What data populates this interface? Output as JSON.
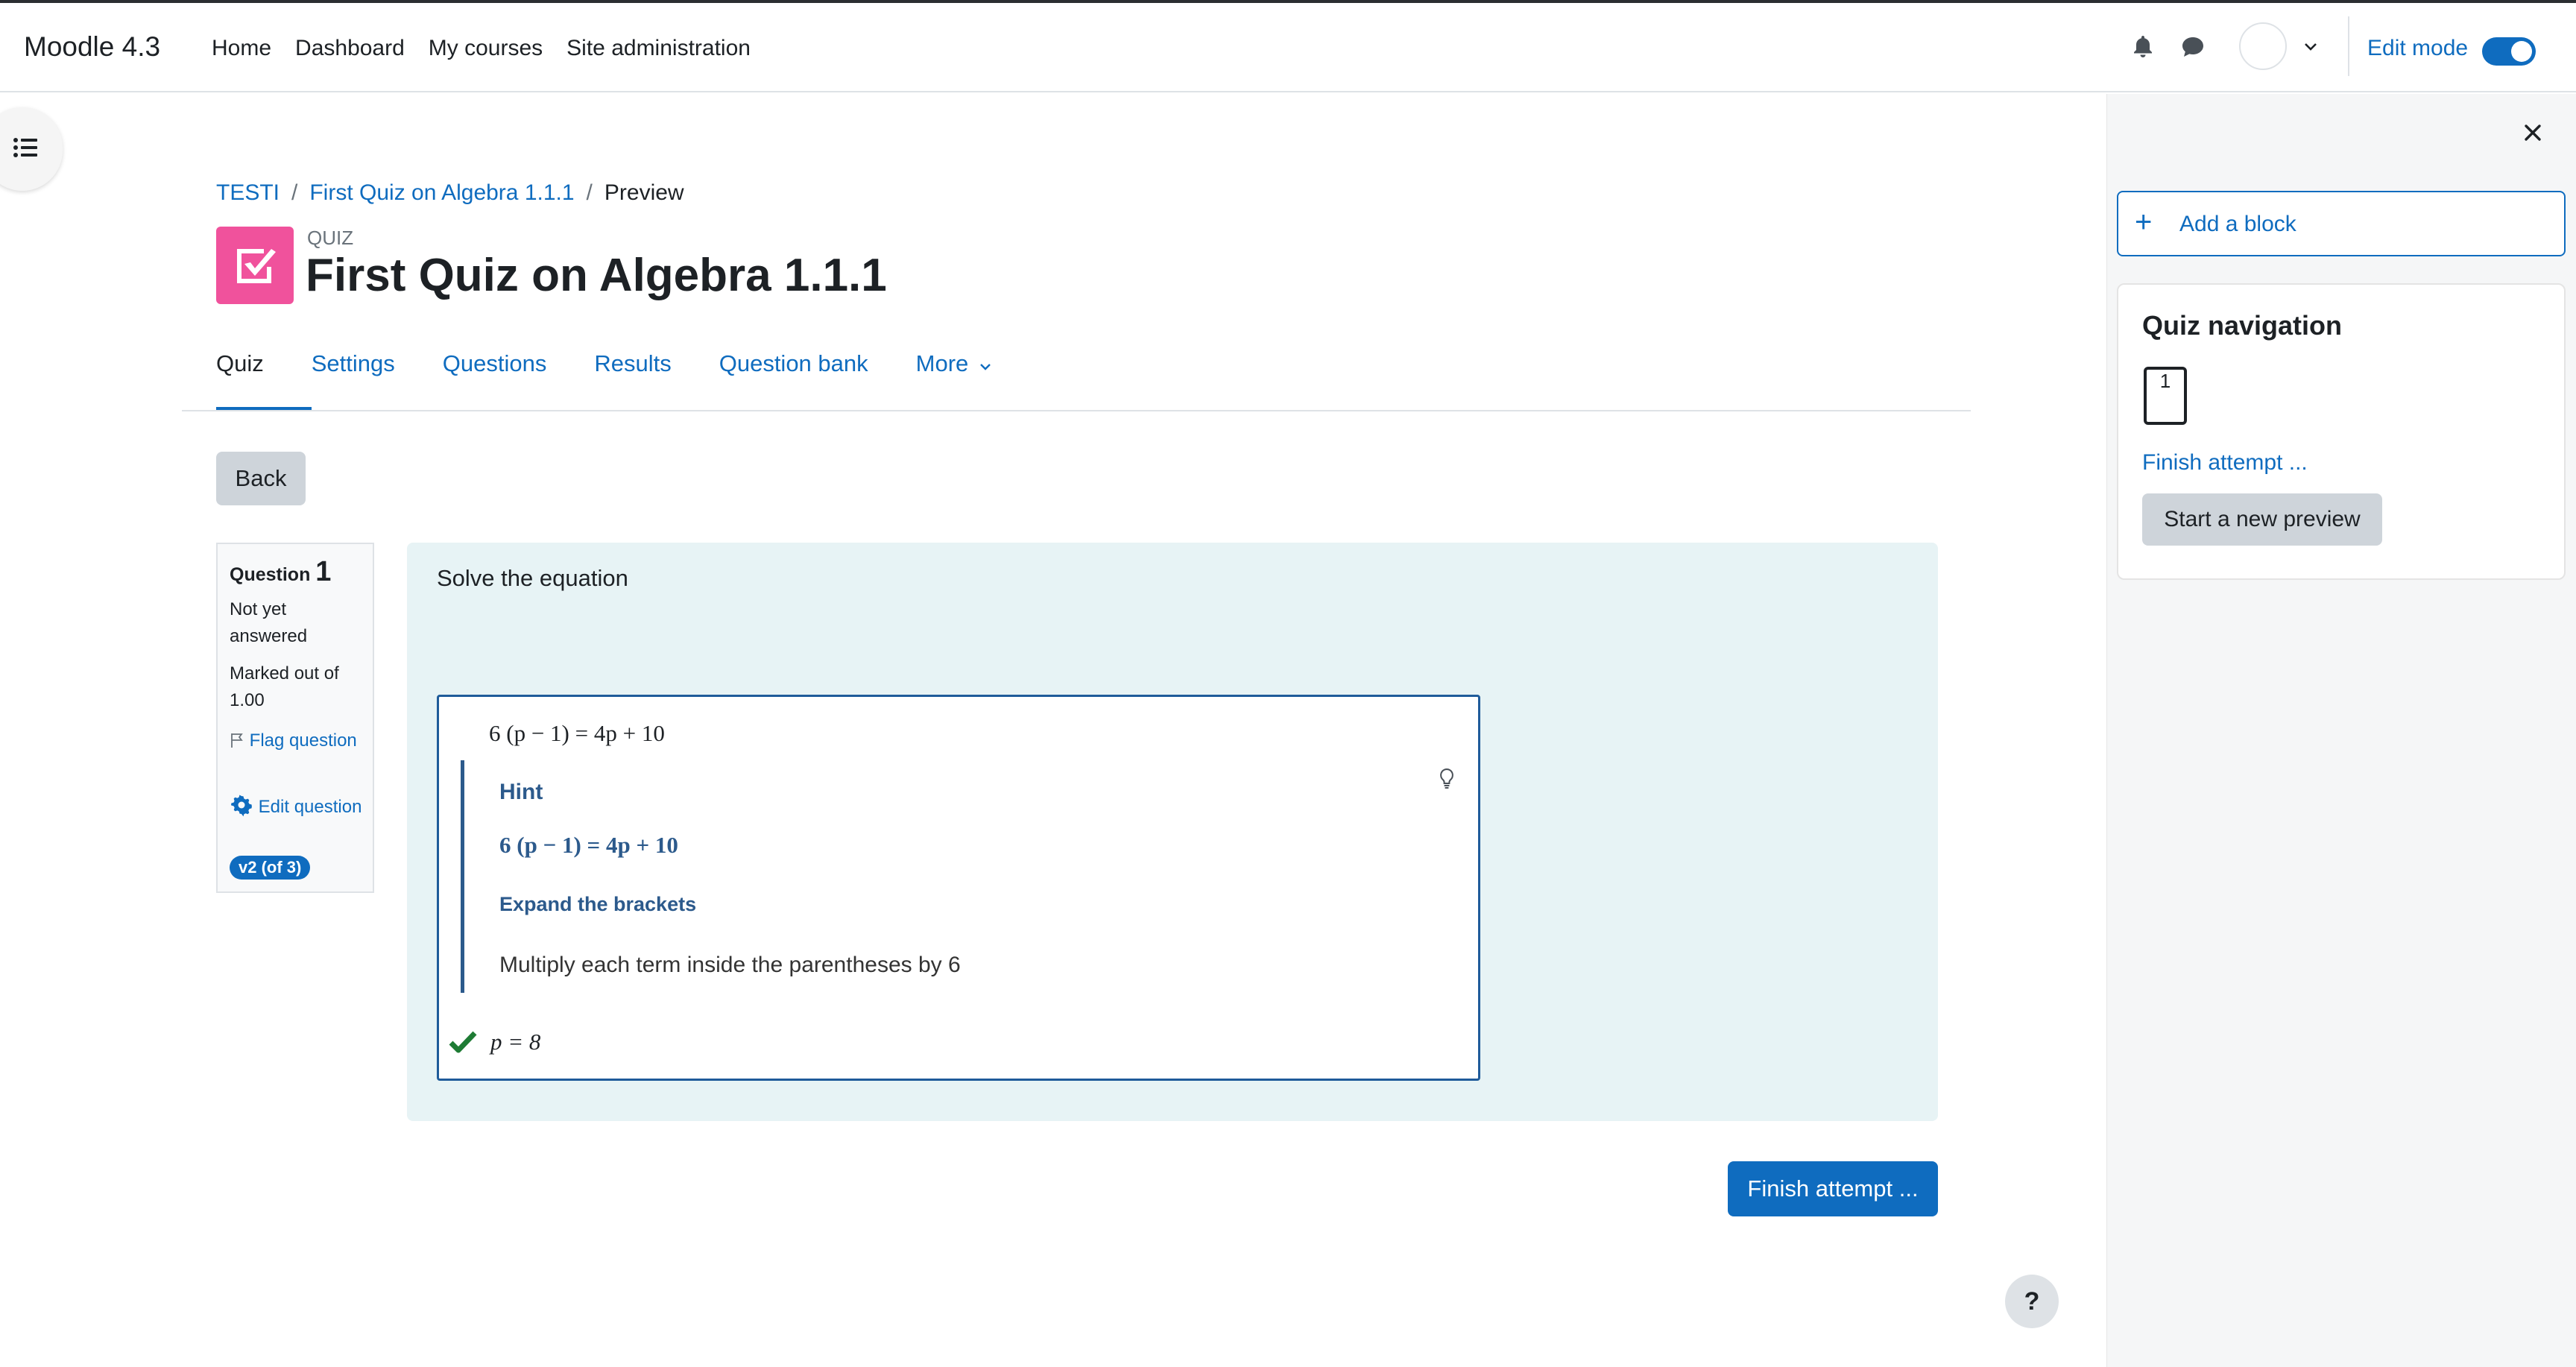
{
  "brand": "Moodle 4.3",
  "primary_nav": {
    "home": "Home",
    "dashboard": "Dashboard",
    "my_courses": "My courses",
    "site_admin": "Site administration"
  },
  "edit_mode": {
    "label": "Edit mode",
    "enabled": true
  },
  "breadcrumb": {
    "course": "TESTI",
    "quiz": "First Quiz on Algebra 1.1.1",
    "current": "Preview",
    "separator": "/"
  },
  "header": {
    "module_type": "QUIZ",
    "title": "First Quiz on Algebra 1.1.1"
  },
  "secondary_nav": {
    "quiz": "Quiz",
    "settings": "Settings",
    "questions": "Questions",
    "results": "Results",
    "question_bank": "Question bank",
    "more": "More"
  },
  "back_label": "Back",
  "question": {
    "label": "Question",
    "number": "1",
    "state": "Not yet answered",
    "grade": "Marked out of 1.00",
    "flag_label": "Flag question",
    "edit_label": "Edit question",
    "version": "v2 (of 3)",
    "text": "Solve the equation",
    "equation": "6 (p − 1) = 4p + 10",
    "hint_title": "Hint",
    "hint_equation": "6 (p − 1) = 4p + 10",
    "hint_subtitle": "Expand the brackets",
    "hint_text": "Multiply each term inside the parentheses by 6",
    "answer": "p = 8"
  },
  "finish_button": "Finish attempt ...",
  "help_label": "?",
  "drawer": {
    "add_block": "Add a block",
    "add_block_icon": "+",
    "quiz_nav_title": "Quiz navigation",
    "question_buttons": [
      "1"
    ],
    "finish_link": "Finish attempt ...",
    "new_preview": "Start a new preview"
  },
  "colors": {
    "accent": "#0f6cbf",
    "quiz_icon": "#f0529c",
    "question_bg": "#e7f3f5",
    "correct": "#1e7b34"
  }
}
